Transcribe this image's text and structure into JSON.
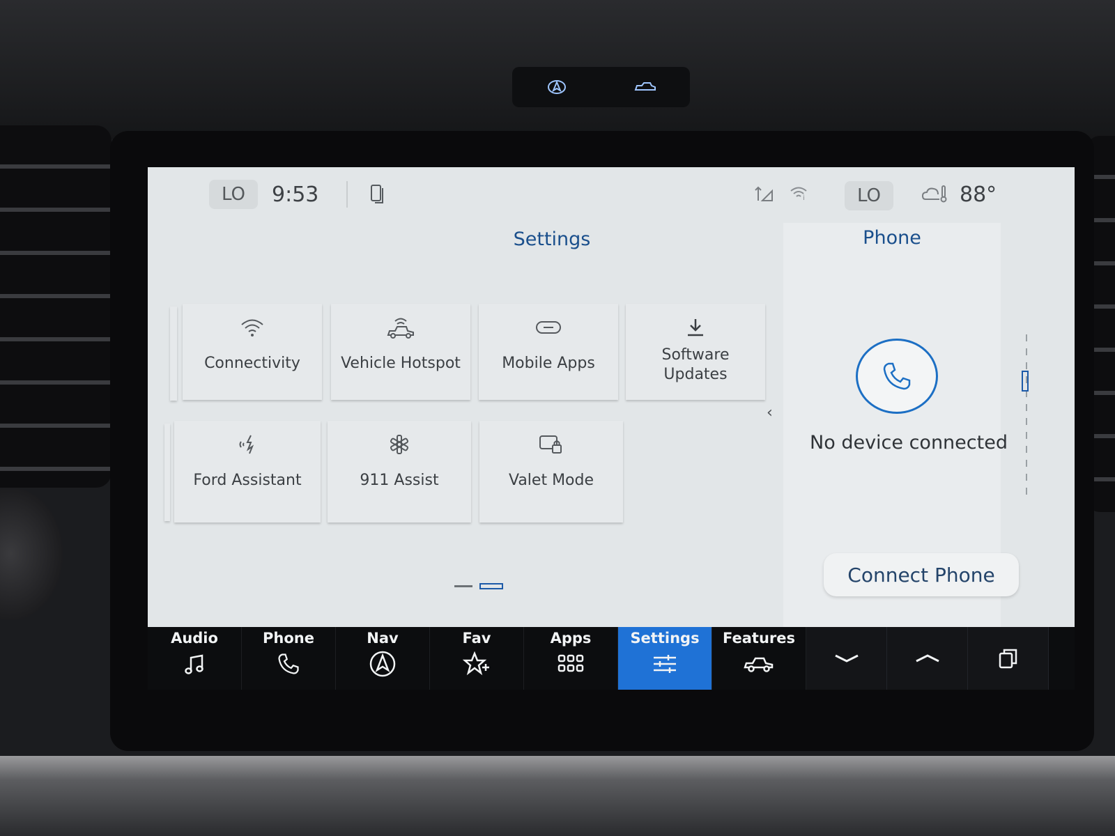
{
  "status_bar": {
    "left_temp": "LO",
    "time": "9:53",
    "right_temp": "LO",
    "outside_temp": "88°"
  },
  "settings": {
    "title": "Settings",
    "tiles": [
      {
        "label": "Connectivity",
        "icon": "wifi-icon"
      },
      {
        "label": "Vehicle Hotspot",
        "icon": "hotspot-icon"
      },
      {
        "label": "Mobile Apps",
        "icon": "link-icon"
      },
      {
        "label": "Software\nUpdates",
        "icon": "download-icon"
      },
      {
        "label": "Ford Assistant",
        "icon": "voice-assistant-icon"
      },
      {
        "label": "911 Assist",
        "icon": "asterisk-icon"
      },
      {
        "label": "Valet Mode",
        "icon": "lock-screen-icon"
      }
    ],
    "pages": {
      "current": 2,
      "total": 2
    }
  },
  "phone_panel": {
    "title": "Phone",
    "status": "No device connected",
    "connect_button": "Connect Phone"
  },
  "nav_bar": {
    "items": [
      {
        "label": "Audio",
        "icon": "music-note-icon"
      },
      {
        "label": "Phone",
        "icon": "phone-icon"
      },
      {
        "label": "Nav",
        "icon": "navigation-icon"
      },
      {
        "label": "Fav",
        "icon": "star-plus-icon"
      },
      {
        "label": "Apps",
        "icon": "grid-icon"
      },
      {
        "label": "Settings",
        "icon": "sliders-icon"
      },
      {
        "label": "Features",
        "icon": "vehicle-icon"
      }
    ],
    "active": "Settings"
  },
  "colors": {
    "accent": "#1f72d6",
    "title_blue": "#1a4f8c",
    "screen_bg": "#e2e6e8"
  }
}
